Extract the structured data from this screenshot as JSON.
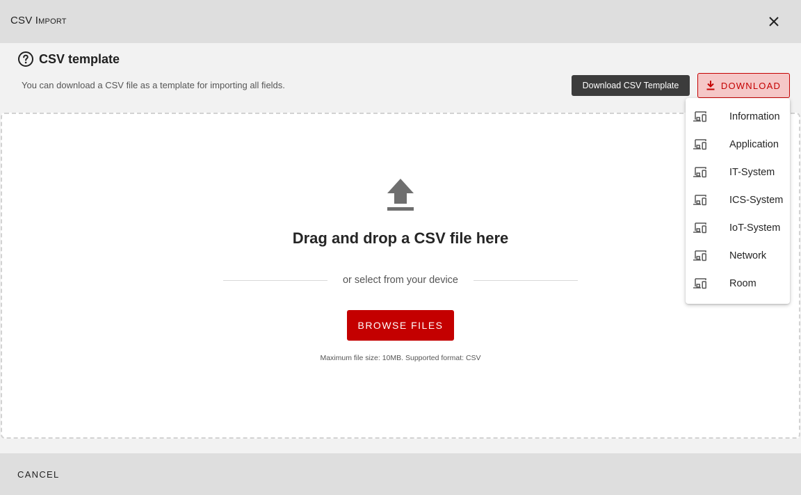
{
  "dialog": {
    "title": "CSV Import"
  },
  "section": {
    "title": "CSV template",
    "description": "You can download a CSV file as a template for importing all fields.",
    "template_button_label": "Download CSV Template",
    "download_button_label": "DOWNLOAD"
  },
  "dropzone": {
    "title": "Drag and drop a CSV file here",
    "or_text": "or select from your device",
    "browse_label": "BROWSE FILES",
    "hint": "Maximum file size: 10MB. Supported format: CSV"
  },
  "download_menu": {
    "items": [
      {
        "label": "Information",
        "icon": "devices-icon"
      },
      {
        "label": "Application",
        "icon": "devices-icon"
      },
      {
        "label": "IT-System",
        "icon": "devices-icon"
      },
      {
        "label": "ICS-System",
        "icon": "devices-icon"
      },
      {
        "label": "IoT-System",
        "icon": "devices-icon"
      },
      {
        "label": "Network",
        "icon": "devices-icon"
      },
      {
        "label": "Room",
        "icon": "devices-icon"
      }
    ]
  },
  "footer": {
    "cancel_label": "CANCEL"
  },
  "colors": {
    "accent": "#c40000",
    "accent_light": "#f5c7c7",
    "dark_button": "#3c3c3c",
    "header_bg": "#dedede"
  }
}
